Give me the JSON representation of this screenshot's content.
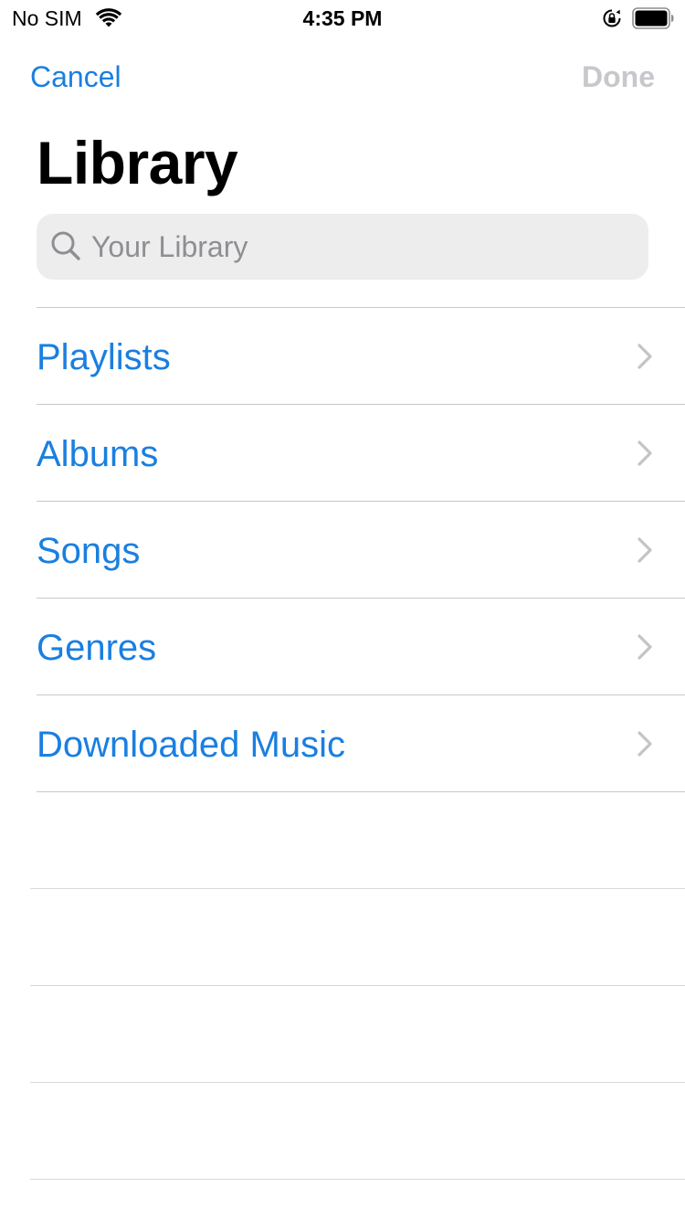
{
  "status_bar": {
    "carrier": "No SIM",
    "time": "4:35 PM"
  },
  "nav": {
    "cancel_label": "Cancel",
    "done_label": "Done"
  },
  "title": "Library",
  "search": {
    "placeholder": "Your Library",
    "value": ""
  },
  "list": {
    "items": [
      {
        "label": "Playlists"
      },
      {
        "label": "Albums"
      },
      {
        "label": "Songs"
      },
      {
        "label": "Genres"
      },
      {
        "label": "Downloaded Music"
      }
    ]
  },
  "colors": {
    "accent": "#1a7fe0",
    "disabled": "#c7c7cc",
    "search_bg": "#ededee",
    "separator": "#c8c7cc",
    "placeholder": "#8e8e93"
  },
  "icons": [
    "wifi-icon",
    "orientation-lock-icon",
    "battery-icon",
    "search-icon",
    "chevron-right-icon"
  ]
}
